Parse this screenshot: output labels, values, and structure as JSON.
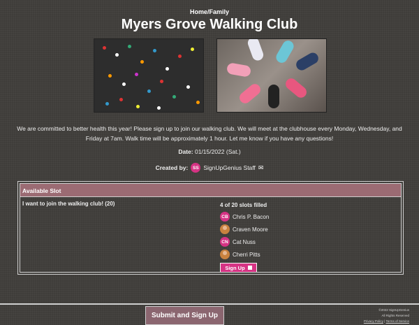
{
  "breadcrumb": "Home/Family",
  "title": "Myers Grove Walking Club",
  "images": {
    "left": "walkers-aerial-photo",
    "right": "sneakers-circle-photo"
  },
  "description": "We are committed to better health this year! Please sign up to join our walking club.  We will meet at the clubhouse every Monday, Wednesday, and Friday at 7am. Walk time will be approximately 1 hour. Let me know if you have any questions!",
  "date": {
    "label": "Date:",
    "value": "01/15/2022 (Sat.)"
  },
  "created_by": {
    "label": "Created by:",
    "initials": "SS",
    "name": "SignUpGenius Staff",
    "icon": "mail-icon"
  },
  "table": {
    "header": "Available Slot",
    "slot_name": "I want to join the walking club! (20)",
    "filled_text": "4 of 20 slots filled",
    "signers": [
      {
        "initials": "CB",
        "name": "Chris P. Bacon",
        "avatar": "initials"
      },
      {
        "initials": "",
        "name": "Craven Moore",
        "avatar": "photo"
      },
      {
        "initials": "CN",
        "name": "Cat Nuss",
        "avatar": "initials"
      },
      {
        "initials": "",
        "name": "Cherri Pitts",
        "avatar": "photo"
      }
    ],
    "signup_label": "Sign Up"
  },
  "submit_label": "Submit and Sign Up",
  "legal": {
    "copyright": "©2022 SignUpGenius",
    "rights": "All Rights Reserved",
    "privacy": "Privacy Policy",
    "separator": "|",
    "terms": "Terms of Service"
  },
  "colors": {
    "accent": "#d63384",
    "header_bg": "#9b6b73",
    "button_bg": "#8b6670",
    "page_bg": "#3f3d3a"
  }
}
